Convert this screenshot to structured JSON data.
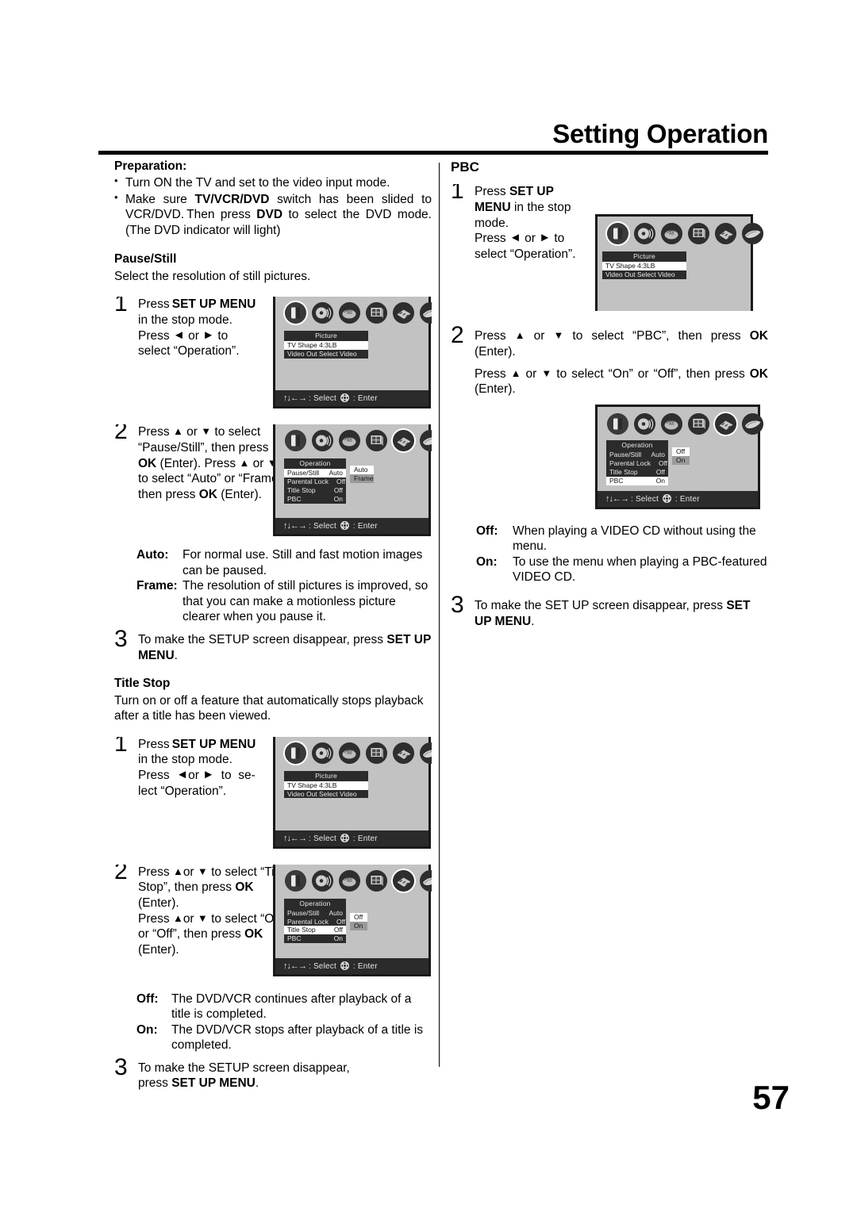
{
  "page": {
    "title": "Setting Operation",
    "number": "57"
  },
  "left": {
    "preparation": {
      "heading": "Preparation:",
      "bullets": [
        "Turn ON the TV and set to the video input mode.",
        "Make sure TV/VCR/DVD switch has been slided to VCR/DVD. Then press DVD to select the DVD mode. (The DVD indicator will light)"
      ]
    },
    "pause_still": {
      "heading": "Pause/Still",
      "intro": "Select the resolution of still pictures.",
      "step1": {
        "num": "1",
        "line1_a": "Press ",
        "line1_b": "SET UP MENU",
        "line2": "in the stop mode.",
        "line3_a": "Press ",
        "line3_b": " or ",
        "line3_c": " to",
        "line4": "select “Operation”."
      },
      "step2": {
        "num": "2",
        "text": "Press ▲ or ▼ to select “Pause/Still”, then press OK (Enter). Press ▲ or ▼ to select “Auto” or “Frame”, then press OK (Enter)."
      },
      "defs": [
        {
          "term": "Auto:",
          "desc": "For normal use. Still and fast motion images can be paused."
        },
        {
          "term": "Frame:",
          "desc": "The resolution of still pictures is improved, so that you can make a motionless picture clearer when you pause it."
        }
      ],
      "step3": {
        "num": "3",
        "text_a": "To make the SETUP screen disappear, press ",
        "text_b": "SET UP MENU",
        "text_c": "."
      }
    },
    "title_stop": {
      "heading": "Title Stop",
      "intro": "Turn on or off a feature that automatically stops playback after a title has been viewed.",
      "step1": {
        "num": "1",
        "line1_a": "Press ",
        "line1_b": "SET UP MENU",
        "line2": "in the stop mode.",
        "line3_a": "Press ",
        "line3_b": " or ",
        "line3_c": " to se-",
        "line4": "lect “Operation”."
      },
      "step2": {
        "num": "2",
        "text": "Press ▲or ▼ to select “Title Stop”, then press OK (Enter). Press ▲or ▼ to select “On” or “Off”, then press OK (Enter)."
      },
      "defs": [
        {
          "term": "Off:",
          "desc": "The DVD/VCR continues after playback of a title is completed."
        },
        {
          "term": "On:",
          "desc": "The DVD/VCR stops after playback of a title is completed."
        }
      ],
      "step3": {
        "num": "3",
        "text_a": "To make the SETUP screen disappear,",
        "text_b": "press ",
        "text_c": "SET UP MENU",
        "text_d": "."
      }
    }
  },
  "right": {
    "pbc": {
      "heading": "PBC",
      "step1": {
        "num": "1",
        "line1_a": "Press ",
        "line1_b": "SET UP",
        "line2_a": "MENU",
        "line2_b": " in the stop",
        "line3": "mode.",
        "line4_a": "Press ",
        "line4_b": " or ",
        "line4_c": " to",
        "line5": "select “Operation”."
      },
      "step2": {
        "num": "2",
        "para1": "Press ▲ or ▼ to select “PBC”, then press OK (Enter).",
        "para2": "Press ▲ or ▼ to select “On” or “Off”, then press OK (Enter)."
      },
      "defs": [
        {
          "term": "Off:",
          "desc": "When playing a VIDEO CD without using the menu."
        },
        {
          "term": "On:",
          "desc": "To use the menu when playing a PBC-featured VIDEO CD."
        }
      ],
      "step3": {
        "num": "3",
        "text_a": "To make the SET UP screen disappear, press ",
        "text_b": "SET UP MENU",
        "text_c": "."
      }
    }
  },
  "osd": {
    "icons": [
      {
        "name": "picture-icon",
        "label": "Picture"
      },
      {
        "name": "audio-icon",
        "label": "Audio"
      },
      {
        "name": "language-icon",
        "label": "Language"
      },
      {
        "name": "display-icon",
        "label": "Display"
      },
      {
        "name": "operation-icon",
        "label": "Operation"
      },
      {
        "name": "disc-icon",
        "label": "Disc"
      }
    ],
    "footer": {
      "arrows": "↑↓←→",
      "select_label": ": Select",
      "enter_label": ": Enter"
    },
    "picture_menu": {
      "title": "Picture",
      "rows": [
        {
          "label": "TV Shape 4:3LB",
          "value": "",
          "highlight": true
        },
        {
          "label": "Video Out Select Video",
          "value": "",
          "highlight": false
        }
      ]
    },
    "operation_menu": {
      "title": "Operation",
      "rows": [
        {
          "label": "Pause/Still",
          "value": "Auto"
        },
        {
          "label": "Parental Lock",
          "value": "Off"
        },
        {
          "label": "Title Stop",
          "value": "Off"
        },
        {
          "label": "PBC",
          "value": "On"
        }
      ]
    },
    "sub_autoframe": {
      "options": [
        "Auto",
        "Frame"
      ],
      "selected": "Auto"
    },
    "sub_offon": {
      "options": [
        "Off",
        "On"
      ],
      "selected": "Off"
    }
  }
}
